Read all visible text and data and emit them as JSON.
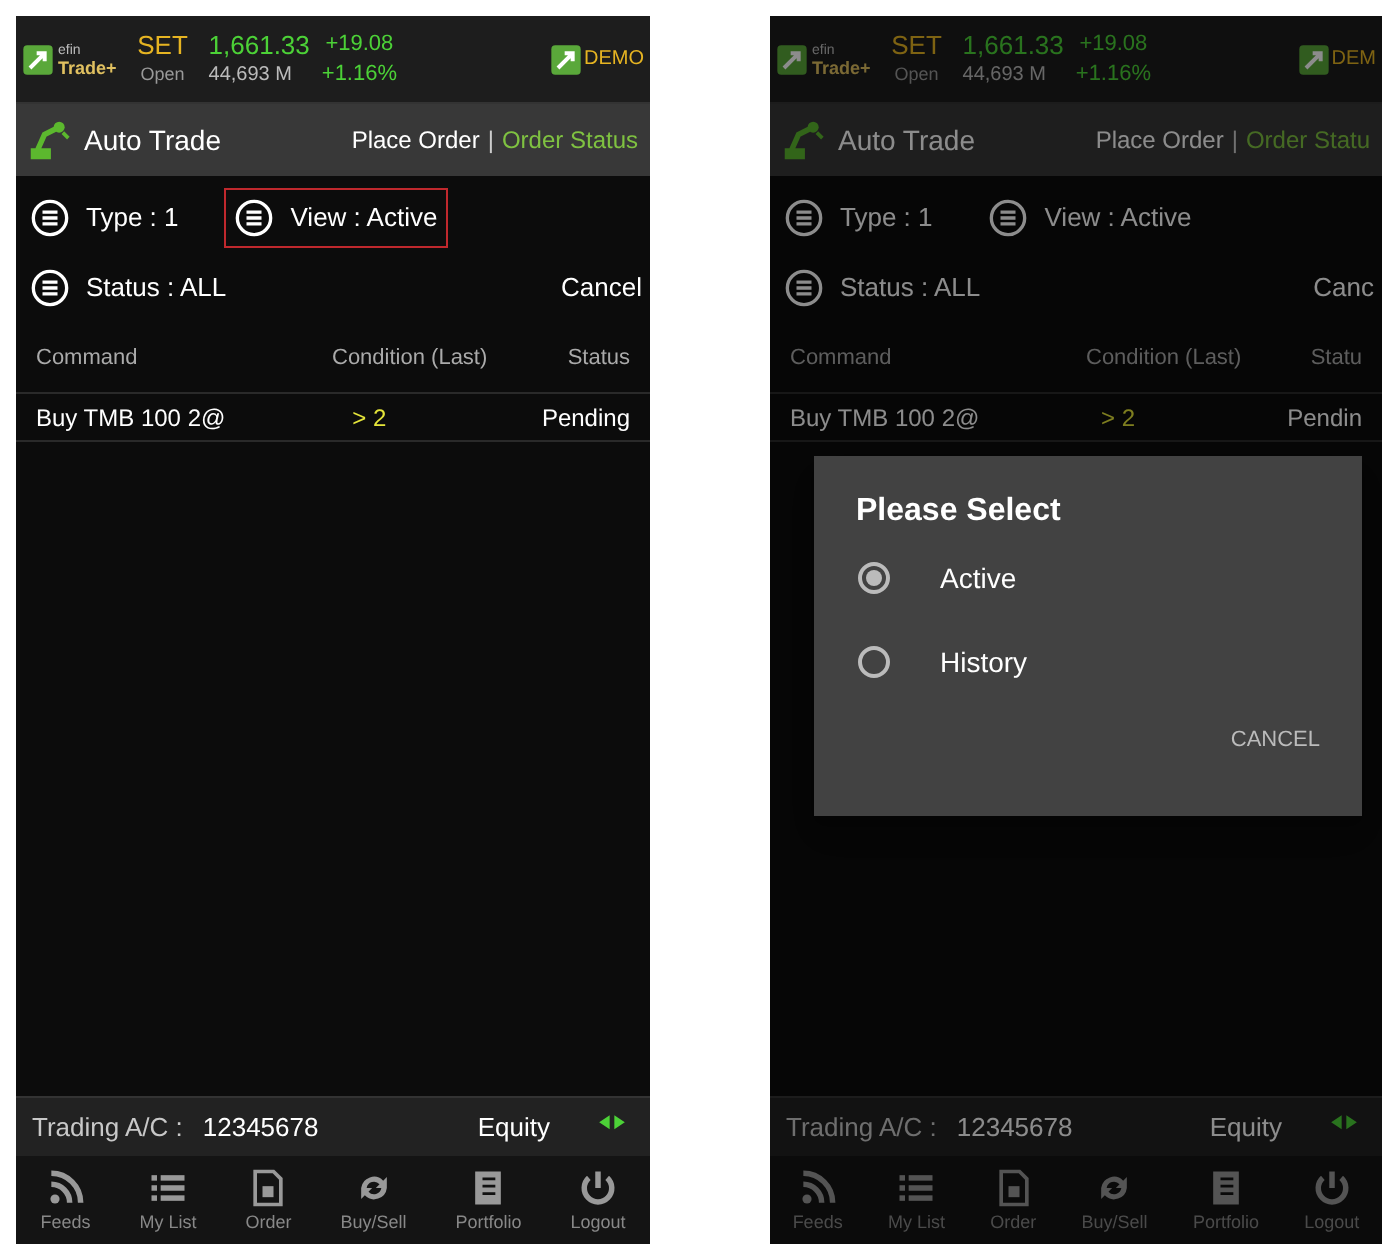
{
  "screens": [
    {
      "header": {
        "logo_top": "efin",
        "logo_bottom": "Trade+",
        "market": "SET",
        "session": "Open",
        "index": "1,661.33",
        "volume": "44,693 M",
        "change": "+19.08",
        "change_pct": "+1.16%",
        "badge": "DEMO"
      },
      "nav": {
        "title": "Auto Trade",
        "separator": "|",
        "links": [
          {
            "label": "Place Order",
            "selected": false
          },
          {
            "label": "Order Status",
            "selected": true
          }
        ]
      },
      "filters": [
        {
          "label": "Type : 1",
          "highlighted": false
        },
        {
          "label": "View : Active",
          "highlighted": true
        },
        {
          "label": "Status : ALL",
          "highlighted": false
        }
      ],
      "cancel": "Cancel",
      "table": {
        "columns": [
          "Command",
          "Condition (Last)",
          "Status"
        ],
        "rows": [
          {
            "command": "Buy TMB 100 2@",
            "condition": "> 2",
            "status": "Pending"
          }
        ]
      },
      "account": {
        "label": "Trading A/C :",
        "number": "12345678",
        "type": "Equity"
      },
      "tabs": [
        {
          "label": "Feeds",
          "kind": "feeds"
        },
        {
          "label": "My List",
          "kind": "list"
        },
        {
          "label": "Order",
          "kind": "order"
        },
        {
          "label": "Buy/Sell",
          "kind": "sync"
        },
        {
          "label": "Portfolio",
          "kind": "book"
        },
        {
          "label": "Logout",
          "kind": "power"
        }
      ],
      "dimmed": false
    },
    {
      "header": {
        "logo_top": "efin",
        "logo_bottom": "Trade+",
        "market": "SET",
        "session": "Open",
        "index": "1,661.33",
        "volume": "44,693 M",
        "change": "+19.08",
        "change_pct": "+1.16%",
        "badge": "DEM"
      },
      "nav": {
        "title": "Auto Trade",
        "separator": "|",
        "links": [
          {
            "label": "Place Order",
            "selected": false
          },
          {
            "label": "Order Statu",
            "selected": true
          }
        ]
      },
      "filters": [
        {
          "label": "Type : 1",
          "highlighted": false
        },
        {
          "label": "View : Active",
          "highlighted": false
        },
        {
          "label": "Status : ALL",
          "highlighted": false
        }
      ],
      "cancel": "Canc",
      "table": {
        "columns": [
          "Command",
          "Condition (Last)",
          "Statu"
        ],
        "rows": [
          {
            "command": "Buy TMB 100 2@",
            "condition": "> 2",
            "status": "Pendin"
          }
        ]
      },
      "account": {
        "label": "Trading A/C :",
        "number": "12345678",
        "type": "Equity"
      },
      "tabs": [
        {
          "label": "Feeds",
          "kind": "feeds"
        },
        {
          "label": "My List",
          "kind": "list"
        },
        {
          "label": "Order",
          "kind": "order"
        },
        {
          "label": "Buy/Sell",
          "kind": "sync"
        },
        {
          "label": "Portfolio",
          "kind": "book"
        },
        {
          "label": "Logout",
          "kind": "power"
        }
      ],
      "dimmed": true,
      "dialog": {
        "title": "Please Select",
        "options": [
          {
            "label": "Active",
            "selected": true
          },
          {
            "label": "History",
            "selected": false
          }
        ],
        "button": "CANCEL"
      }
    }
  ]
}
